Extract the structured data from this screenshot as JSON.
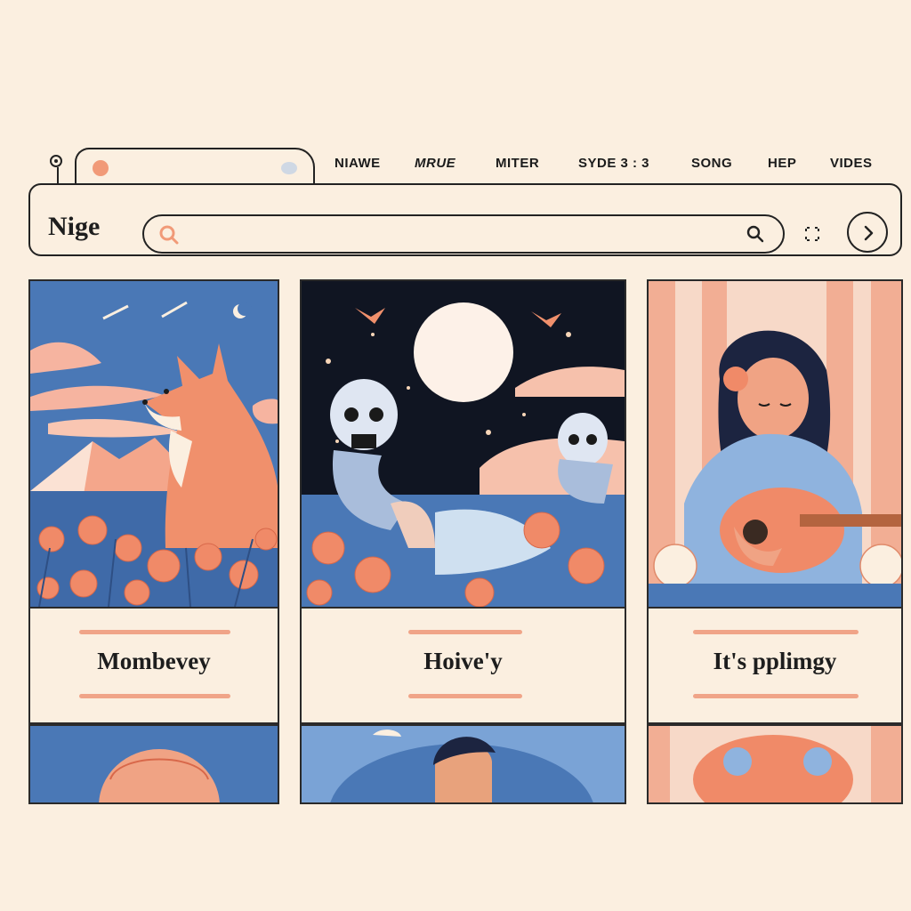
{
  "browser": {
    "nav": [
      "NIAWE",
      "MRUE",
      "MITER",
      "SYDE 3 : 3",
      "SONG",
      "HEP",
      "VIDES"
    ]
  },
  "header": {
    "site_title": "Nige",
    "search": {
      "value": "",
      "placeholder": ""
    }
  },
  "icons": {
    "search_left": "search-icon",
    "search_right": "search-icon",
    "expand": "expand-icon",
    "next": "chevron-right-icon"
  },
  "colors": {
    "background": "#fbefe0",
    "accent": "#f19a78",
    "sky_blue": "#4a78b6",
    "night": "#101522"
  },
  "cards": [
    {
      "title": "Mombevey",
      "art": "fox-illustration"
    },
    {
      "title": "Hoive'y",
      "art": "skeletons-moon-illustration"
    },
    {
      "title": "It's pplimgy",
      "art": "girl-guitar-illustration"
    }
  ]
}
